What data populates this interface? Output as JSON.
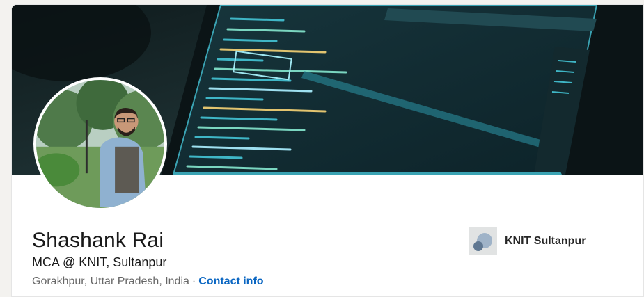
{
  "profile": {
    "name": "Shashank Rai",
    "headline": "MCA @ KNIT, Sultanpur",
    "location": "Gorakhpur, Uttar Pradesh, India",
    "separator": "·",
    "contact_link": "Contact info"
  },
  "education": {
    "name": "KNIT Sultanpur",
    "logo_icon": "school-logo-icon"
  },
  "cover": {
    "image": "laptop-code-editor-photo"
  },
  "avatar": {
    "image": "profile-photo"
  },
  "colors": {
    "link": "#0a66c2",
    "page_background": "#f3f2ef",
    "cover_dark": "#152325"
  }
}
